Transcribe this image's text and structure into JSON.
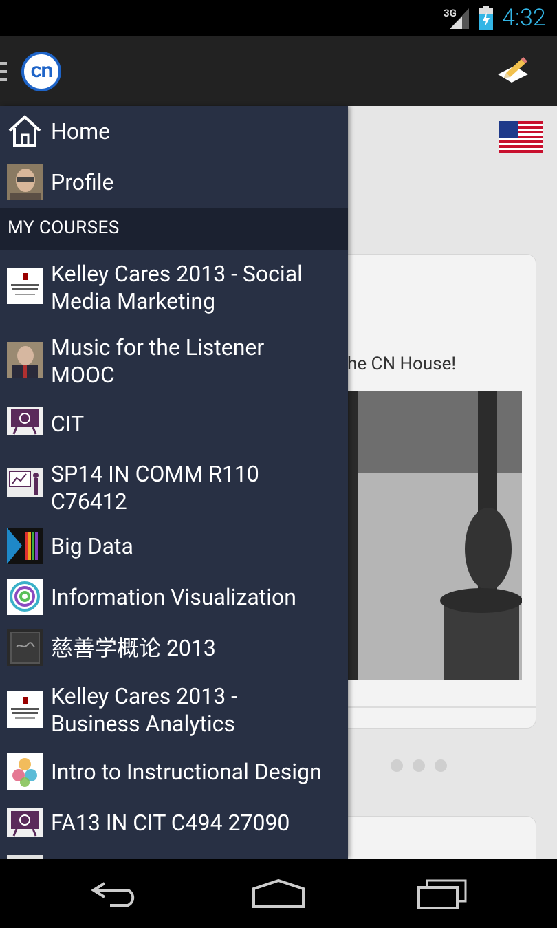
{
  "status_bar": {
    "network": "3G",
    "time": "4:32"
  },
  "drawer": {
    "nav": [
      {
        "label": "Home",
        "icon": "home-icon"
      },
      {
        "label": "Profile",
        "icon": "profile-avatar"
      }
    ],
    "section_title": "MY COURSES",
    "courses": [
      {
        "label_line1": "Kelley Cares 2013 - Social",
        "label_line2": "Media Marketing"
      },
      {
        "label_line1": "Music for the Listener",
        "label_line2": "MOOC"
      },
      {
        "label_line1": "CIT",
        "label_line2": ""
      },
      {
        "label_line1": "SP14 IN COMM R110",
        "label_line2": "C76412"
      },
      {
        "label_line1": "Big Data",
        "label_line2": ""
      },
      {
        "label_line1": "Information Visualization",
        "label_line2": ""
      },
      {
        "label_line1": "慈善学概论 2013",
        "label_line2": ""
      },
      {
        "label_line1": "Kelley Cares 2013 -",
        "label_line2": "Business Analytics"
      },
      {
        "label_line1": "Intro to Instructional Design",
        "label_line2": ""
      },
      {
        "label_line1": "FA13 IN CIT C494 27090",
        "label_line2": ""
      }
    ]
  },
  "content": {
    "post_text": "he CN House!"
  },
  "logo_text": "cn",
  "colors": {
    "accent": "#33b5e5",
    "drawer_bg": "#283044",
    "section_bg": "#1b2130",
    "action_bar": "#222222"
  }
}
